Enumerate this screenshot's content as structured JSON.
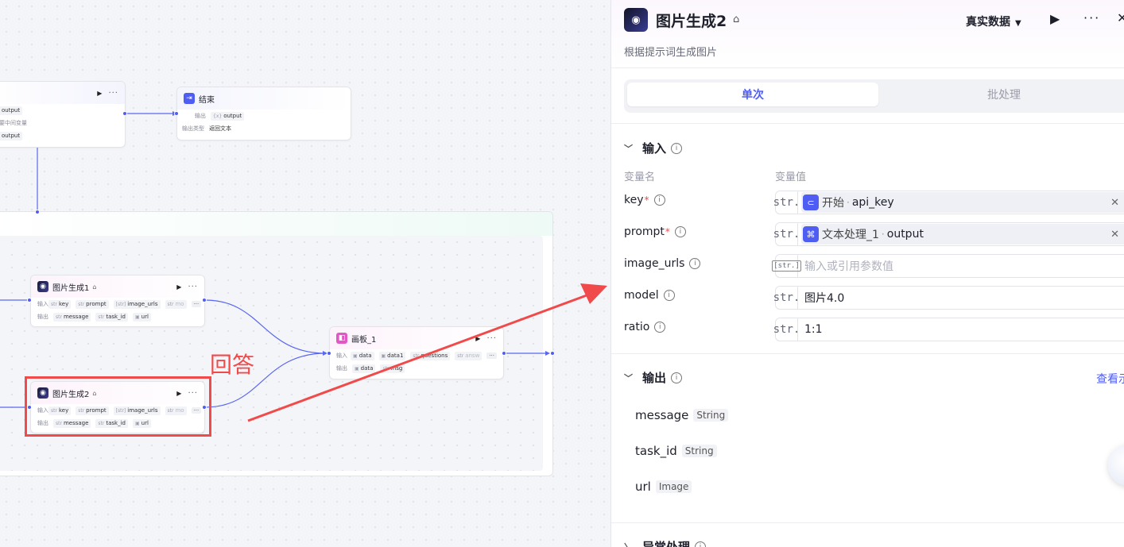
{
  "canvas": {
    "top_node": {
      "row1": "output",
      "row2": "要中间变量",
      "row3": "output"
    },
    "end_node": {
      "title": "结束",
      "output_label": "输出",
      "output_var": "output",
      "type_label": "输出类型",
      "type_value": "返回文本"
    },
    "img_node_1": {
      "title": "图片生成1",
      "input_label": "输入",
      "output_label": "输出",
      "inputs": [
        "key",
        "prompt",
        "image_urls",
        "mo"
      ],
      "outputs": [
        "message",
        "task_id",
        "url"
      ],
      "more": "···"
    },
    "img_node_2": {
      "title": "图片生成2",
      "input_label": "输入",
      "output_label": "输出",
      "inputs": [
        "key",
        "prompt",
        "image_urls",
        "mo"
      ],
      "outputs": [
        "message",
        "task_id",
        "url"
      ],
      "more": "···"
    },
    "board_node": {
      "title": "画板_1",
      "input_label": "输入",
      "output_label": "输出",
      "inputs": [
        "data",
        "data1",
        "questions",
        "answ"
      ],
      "outputs": [
        "data",
        "msg"
      ],
      "more": "···"
    },
    "annotation_text": "回答",
    "annotation_color": "#f04a4a"
  },
  "panel": {
    "title": "图片生成2",
    "description": "根据提示词生成图片",
    "data_select": "真实数据",
    "tabs": [
      {
        "label": "单次",
        "active": true
      },
      {
        "label": "批处理",
        "active": false
      }
    ],
    "input_section": {
      "title": "输入",
      "col_name": "变量名",
      "col_value": "变量值",
      "rows": [
        {
          "name": "key",
          "required": true,
          "type": "str.",
          "ref_source": "开始",
          "ref_var": "api_key"
        },
        {
          "name": "prompt",
          "required": true,
          "type": "str.",
          "ref_source": "文本处理_1",
          "ref_var": "output"
        },
        {
          "name": "image_urls",
          "required": false,
          "type": "[str.]",
          "placeholder": "输入或引用参数值"
        },
        {
          "name": "model",
          "required": false,
          "type": "str.",
          "value": "图片4.0"
        },
        {
          "name": "ratio",
          "required": false,
          "type": "str.",
          "value": "1:1"
        }
      ]
    },
    "output_section": {
      "title": "输出",
      "view_more": "查看示",
      "rows": [
        {
          "name": "message",
          "type": "String"
        },
        {
          "name": "task_id",
          "type": "String"
        },
        {
          "name": "url",
          "type": "Image"
        }
      ]
    },
    "exception_section": {
      "title": "异常处理"
    },
    "accent_color": "#4f5df2"
  }
}
